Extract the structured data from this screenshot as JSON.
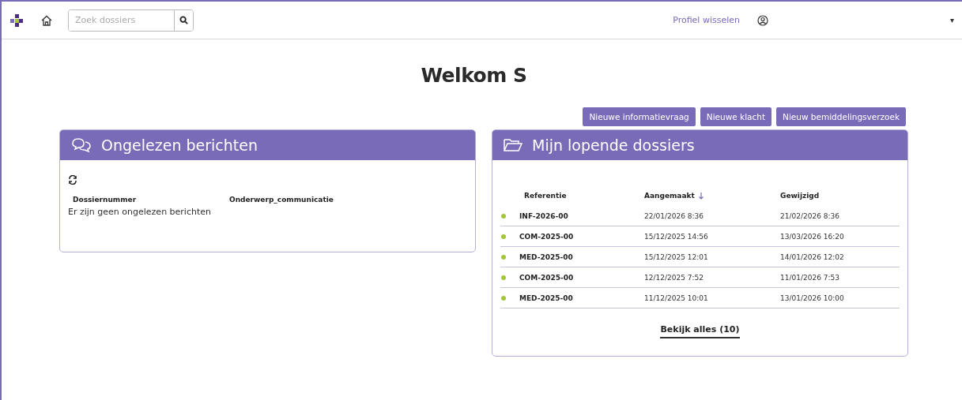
{
  "header": {
    "search": {
      "placeholder": "Zoek dossiers"
    },
    "profile_switch": "Profiel wisselen",
    "user_menu_caret": "▾"
  },
  "welcome": "Welkom S",
  "actions": [
    "Nieuwe informatievraag",
    "Nieuwe klacht",
    "Nieuw bemiddelingsverzoek"
  ],
  "unread": {
    "title": "Ongelezen berichten",
    "columns": [
      "Dossiernummer",
      "Onderwerp_communicatie"
    ],
    "empty": "Er zijn geen ongelezen berichten"
  },
  "dossiers": {
    "title": "Mijn lopende dossiers",
    "columns": [
      {
        "label": "Referentie",
        "sorted": false
      },
      {
        "label": "Aangemaakt",
        "sorted": true
      },
      {
        "label": "Gewijzigd",
        "sorted": false
      }
    ],
    "rows": [
      {
        "reference": "INF-2026-00",
        "created": "22/01/2026 8:36",
        "modified": "21/02/2026 8:36",
        "color": "#a4c639"
      },
      {
        "reference": "COM-2025-00",
        "created": "15/12/2025 14:56",
        "modified": "13/03/2026 16:20",
        "color": "#a4c639"
      },
      {
        "reference": "MED-2025-00",
        "created": "15/12/2025 12:01",
        "modified": "14/01/2026 12:02",
        "color": "#a4c639"
      },
      {
        "reference": "COM-2025-00",
        "created": "12/12/2025 7:52",
        "modified": "11/01/2026 7:53",
        "color": "#a4c639"
      },
      {
        "reference": "MED-2025-00",
        "created": "11/12/2025 10:01",
        "modified": "13/01/2026 10:00",
        "color": "#a4c639"
      }
    ],
    "view_all": "Bekijk alles (10)"
  }
}
